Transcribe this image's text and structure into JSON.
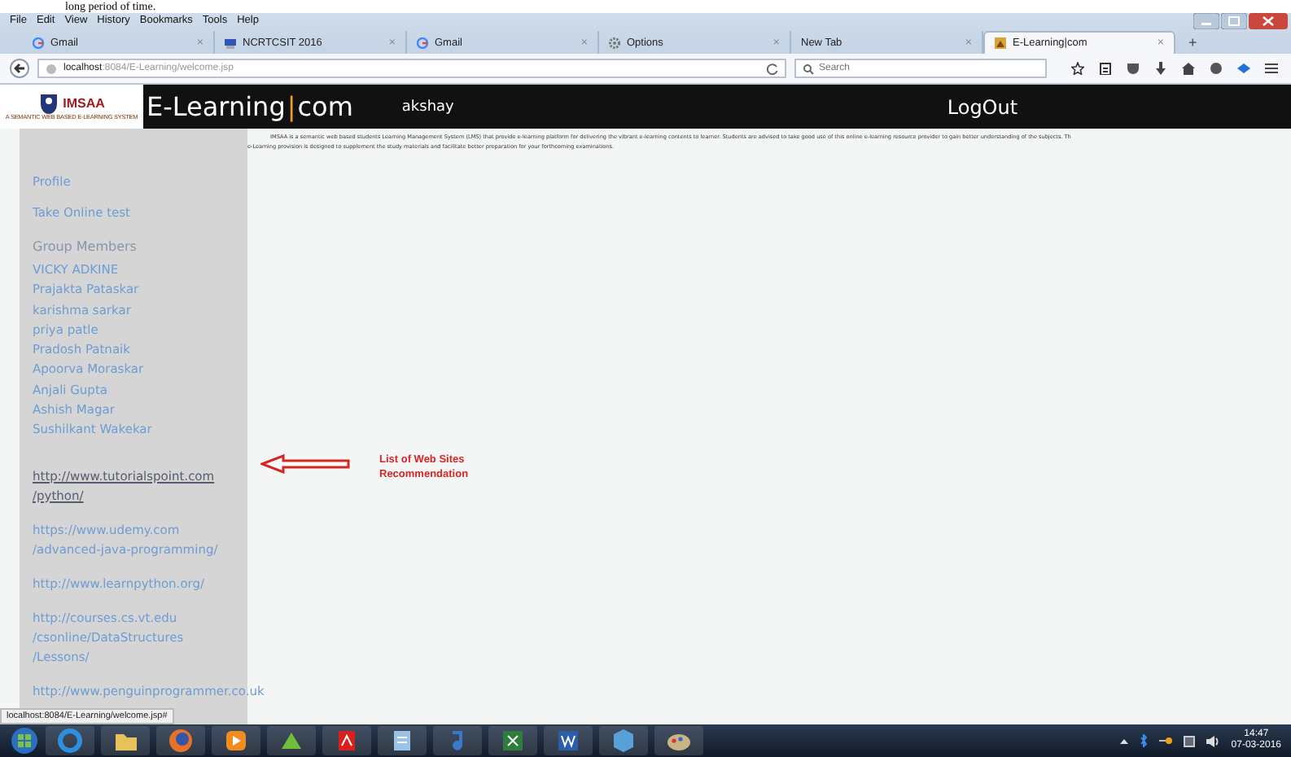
{
  "document_fragment": "long period of time.",
  "menu": [
    "File",
    "Edit",
    "View",
    "History",
    "Bookmarks",
    "Tools",
    "Help"
  ],
  "tabs": [
    {
      "title": "Gmail",
      "kind": "google",
      "close": "×",
      "selected": false
    },
    {
      "title": "NCRTCSIT 2016",
      "kind": "page",
      "close": "×",
      "selected": false
    },
    {
      "title": "Gmail",
      "kind": "google",
      "close": "×",
      "selected": false
    },
    {
      "title": "Options",
      "kind": "gear",
      "close": "×",
      "selected": false
    },
    {
      "title": "New Tab",
      "kind": "none",
      "close": "×",
      "selected": false
    },
    {
      "title": "E-Learning|com",
      "kind": "site",
      "close": "×",
      "selected": true
    }
  ],
  "new_tab": "+",
  "address": {
    "host": "localhost",
    "path": ":8084/E-Learning/welcome.jsp"
  },
  "search": {
    "placeholder": "Search"
  },
  "site": {
    "logo_text": "IMSAA",
    "logo_tagline": "A SEMANTIC WEB BASED E-LEARNING SYSTEM",
    "title_left": "E-Learning",
    "separator": "|",
    "title_right": "com",
    "user": "akshay",
    "logout": "LogOut"
  },
  "intro": [
    "IMSAA is a semantic web based students Learning Management System (LMS) that provide e-learning platform for delivering the vibrant e-learning contents to learner. Students are advised  to take good use of this online e-learning resource provider to gain better understanding of the subjects. Th",
    "e-Learning provision is designed to supplement the study materials and facilitate  better preparation for your forthcoming examinations."
  ],
  "sidebar": {
    "links": [
      "Profile",
      "Take Online test"
    ],
    "group_heading": "Group Members",
    "members": [
      "VICKY ADKINE",
      "Prajakta Pataskar",
      "karishma sarkar",
      "priya patle",
      "Pradosh Patnaik",
      "Apoorva Moraskar",
      "Anjali Gupta",
      "Ashish Magar",
      "Sushilkant Wakekar"
    ],
    "sites": [
      {
        "lines": [
          "http://www.tutorialspoint.com",
          "/python/"
        ],
        "hovered": true
      },
      {
        "lines": [
          "https://www.udemy.com",
          "/advanced-java-programming/"
        ],
        "hovered": false
      },
      {
        "lines": [
          "http://www.learnpython.org/"
        ],
        "hovered": false
      },
      {
        "lines": [
          "http://courses.cs.vt.edu",
          "/csonline/DataStructures",
          "/Lessons/"
        ],
        "hovered": false
      },
      {
        "lines": [
          "http://www.penguinprogrammer.co.uk"
        ],
        "hovered": false
      }
    ]
  },
  "annotation": [
    "List of Web Sites",
    "Recommendation"
  ],
  "status": "localhost:8084/E-Learning/welcome.jsp#",
  "taskbar": [
    {
      "kind": "orb"
    },
    {
      "kind": "ie"
    },
    {
      "kind": "folder"
    },
    {
      "kind": "firefox"
    },
    {
      "kind": "media"
    },
    {
      "kind": "app"
    },
    {
      "kind": "pdf"
    },
    {
      "kind": "notepad"
    },
    {
      "kind": "paint3"
    },
    {
      "kind": "excel"
    },
    {
      "kind": "word"
    },
    {
      "kind": "box"
    },
    {
      "kind": "palette"
    }
  ],
  "clock": {
    "time": "14:47",
    "date": "07-03-2016"
  }
}
